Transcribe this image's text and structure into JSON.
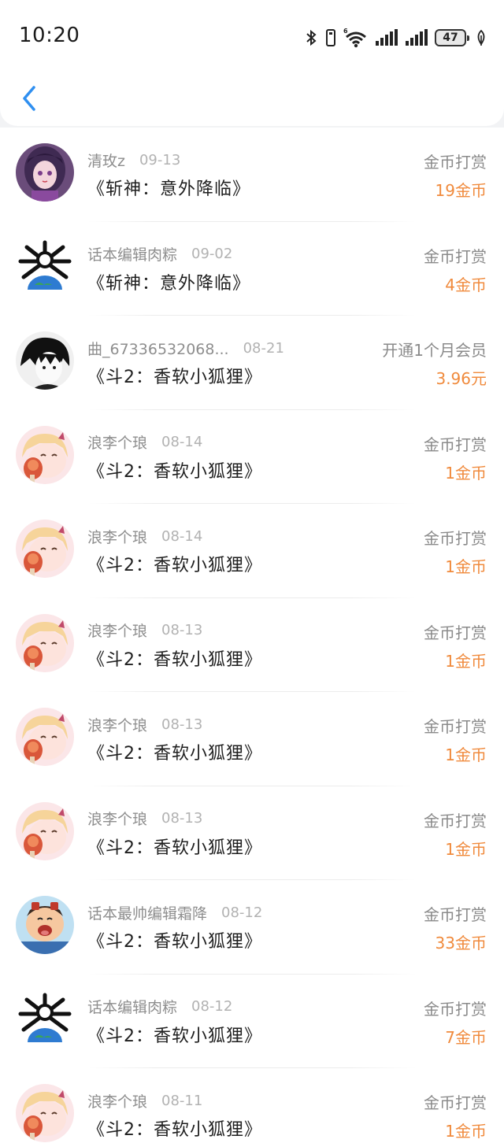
{
  "status_bar": {
    "time": "10:20",
    "battery": "47",
    "wifi_label": "6"
  },
  "nav": {
    "back_icon": "chevron-left-icon",
    "accent_color": "#2f8ff0"
  },
  "colors": {
    "amount": "#f08a3c",
    "secondary_text": "#8e8e8e",
    "date_text": "#b2b2b2"
  },
  "records": [
    {
      "user": "清玫z",
      "date": "09-13",
      "book": "《斩神：意外降临》",
      "type": "金币打赏",
      "amount": "19金币",
      "avatar": "anime-girl-purple"
    },
    {
      "user": "话本编辑肉粽",
      "date": "09-02",
      "book": "《斩神：意外降临》",
      "type": "金币打赏",
      "amount": "4金币",
      "avatar": "earth-spider"
    },
    {
      "user": "曲_67336532068...",
      "date": "08-21",
      "book": "《斗2：香软小狐狸》",
      "type": "开通1个月会员",
      "amount": "3.96元",
      "avatar": "monochrome-boy"
    },
    {
      "user": "浪李个琅",
      "date": "08-14",
      "book": "《斗2：香软小狐狸》",
      "type": "金币打赏",
      "amount": "1金币",
      "avatar": "pink-chibi"
    },
    {
      "user": "浪李个琅",
      "date": "08-14",
      "book": "《斗2：香软小狐狸》",
      "type": "金币打赏",
      "amount": "1金币",
      "avatar": "pink-chibi"
    },
    {
      "user": "浪李个琅",
      "date": "08-13",
      "book": "《斗2：香软小狐狸》",
      "type": "金币打赏",
      "amount": "1金币",
      "avatar": "pink-chibi"
    },
    {
      "user": "浪李个琅",
      "date": "08-13",
      "book": "《斗2：香软小狐狸》",
      "type": "金币打赏",
      "amount": "1金币",
      "avatar": "pink-chibi"
    },
    {
      "user": "浪李个琅",
      "date": "08-13",
      "book": "《斗2：香软小狐狸》",
      "type": "金币打赏",
      "amount": "1金币",
      "avatar": "pink-chibi"
    },
    {
      "user": "话本最帅编辑霜降",
      "date": "08-12",
      "book": "《斗2：香软小狐狸》",
      "type": "金币打赏",
      "amount": "33金币",
      "avatar": "cartoon-kid"
    },
    {
      "user": "话本编辑肉粽",
      "date": "08-12",
      "book": "《斗2：香软小狐狸》",
      "type": "金币打赏",
      "amount": "7金币",
      "avatar": "earth-spider"
    },
    {
      "user": "浪李个琅",
      "date": "08-11",
      "book": "《斗2：香软小狐狸》",
      "type": "金币打赏",
      "amount": "1金币",
      "avatar": "pink-chibi"
    }
  ]
}
